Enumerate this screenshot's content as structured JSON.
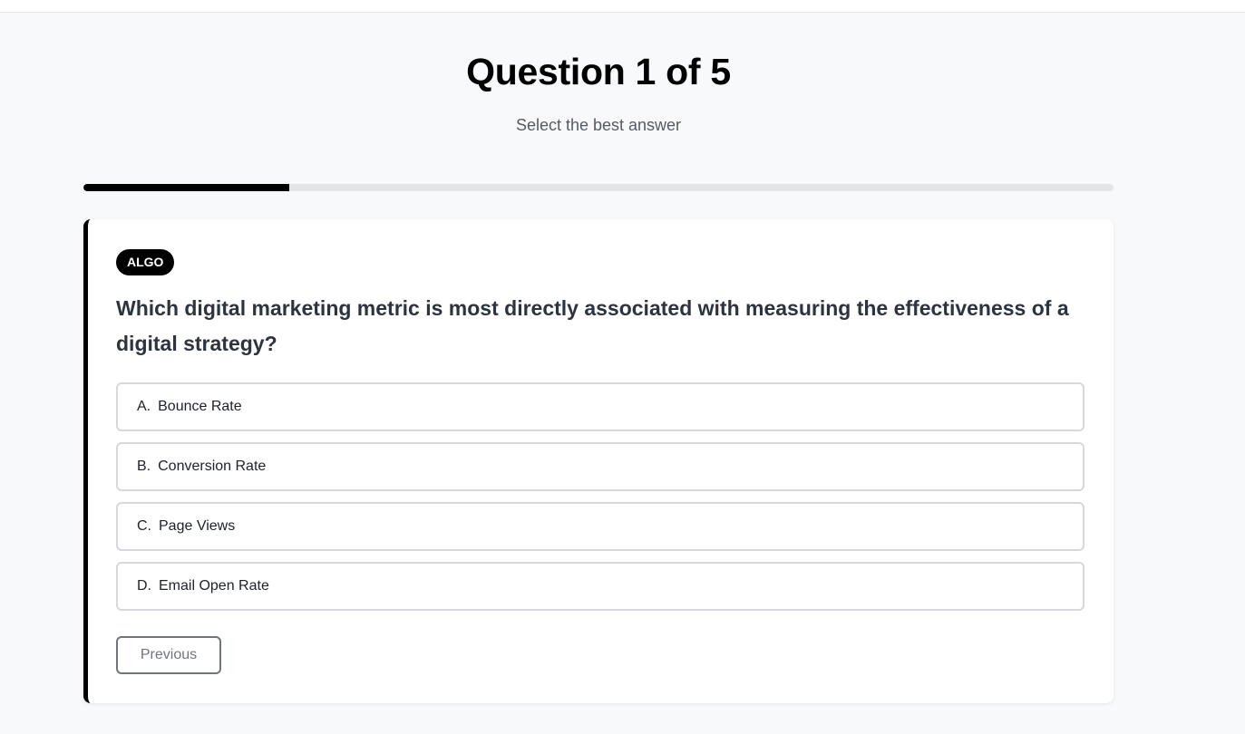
{
  "header": {
    "title": "Question 1 of 5",
    "subtitle": "Select the best answer"
  },
  "progress": {
    "value_fraction": 0.2,
    "fill_color": "#000000",
    "track_color": "#e3e5e8"
  },
  "question": {
    "tag": "ALGO",
    "text": "Which digital marketing metric is most directly associated with measuring the effectiveness of a digital strategy?",
    "options": [
      {
        "letter": "A.",
        "label": "Bounce Rate"
      },
      {
        "letter": "B.",
        "label": "Conversion Rate"
      },
      {
        "letter": "C.",
        "label": "Page Views"
      },
      {
        "letter": "D.",
        "label": "Email Open Rate"
      }
    ]
  },
  "navigation": {
    "previous_label": "Previous"
  }
}
